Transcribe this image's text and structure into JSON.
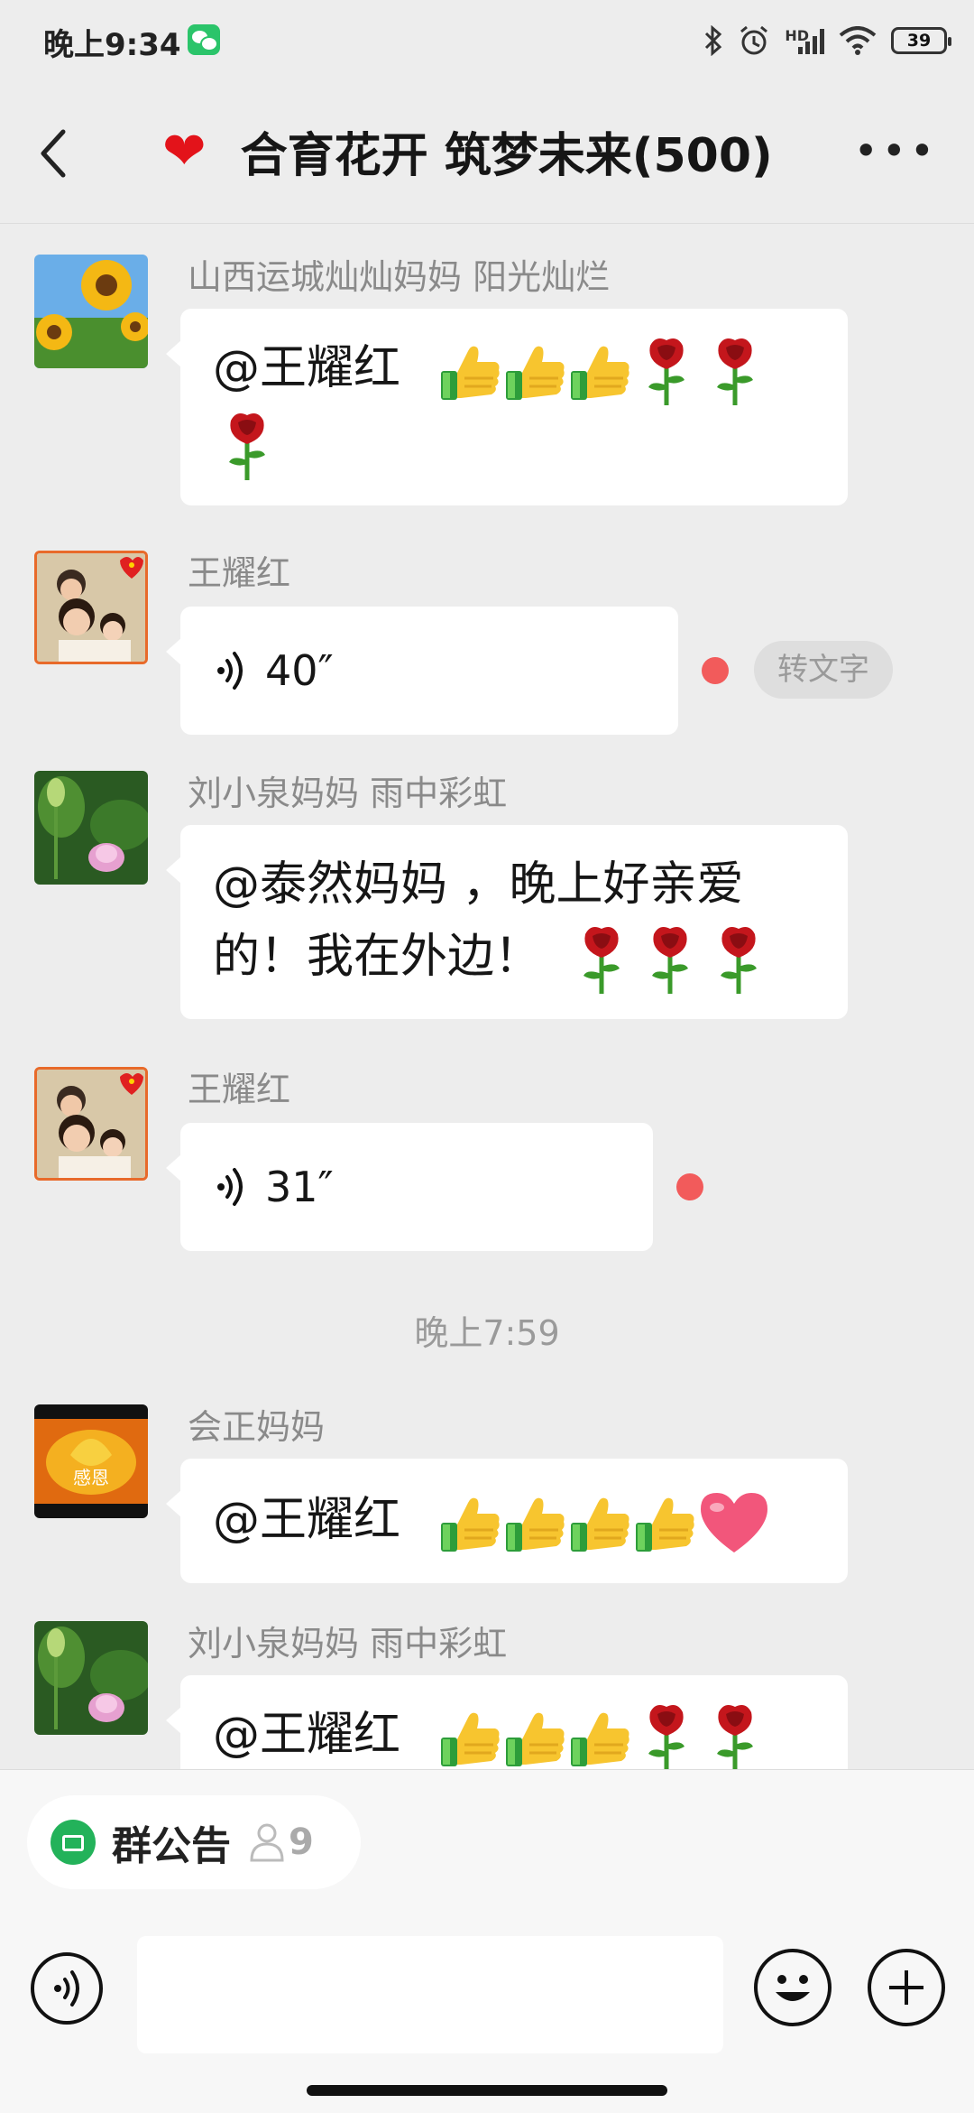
{
  "status_bar": {
    "time": "晚上9:34",
    "app_badge_icon": "wechat-icon",
    "icons": [
      "bluetooth-icon",
      "alarm-icon",
      "hd-signal-icon",
      "wifi-icon",
      "battery-icon"
    ],
    "hd_label": "HD",
    "battery_level": "39"
  },
  "nav": {
    "back_icon": "chevron-left-icon",
    "title_emoji": "❤",
    "title": "合育花开 筑梦未来(500)",
    "more_icon": "more-icon"
  },
  "messages": [
    {
      "sender": "山西运城灿灿妈妈  阳光灿烂",
      "type": "text",
      "mention": "@王耀红",
      "emojis": [
        "thumbs-up",
        "thumbs-up",
        "thumbs-up",
        "rose",
        "rose",
        "rose"
      ]
    },
    {
      "sender": "王耀红",
      "type": "voice",
      "duration": "40″",
      "unread": true,
      "convert_label": "转文字"
    },
    {
      "sender": "刘小泉妈妈  雨中彩虹",
      "type": "text",
      "line1": "@泰然妈妈 ，晚上好亲爱",
      "line2": "的！我在外边！",
      "emojis": [
        "rose",
        "rose",
        "rose"
      ]
    },
    {
      "sender": "王耀红",
      "type": "voice",
      "duration": "31″",
      "unread": true
    },
    {
      "type": "time",
      "text": "晚上7:59"
    },
    {
      "sender": "会正妈妈",
      "type": "text",
      "mention": "@王耀红",
      "avatar_text": "感恩",
      "emojis": [
        "thumbs-up",
        "thumbs-up",
        "thumbs-up",
        "thumbs-up",
        "heart"
      ]
    },
    {
      "sender": "刘小泉妈妈  雨中彩虹",
      "type": "text",
      "mention": "@王耀红",
      "emojis": [
        "thumbs-up",
        "thumbs-up",
        "thumbs-up",
        "rose",
        "rose"
      ]
    }
  ],
  "bottom": {
    "notice_label": "群公告",
    "notice_count": "9",
    "voice_icon": "voice-input-icon",
    "emoji_icon": "emoji-icon",
    "plus_icon": "plus-icon"
  },
  "colors": {
    "background": "#ededed",
    "bubble": "#ffffff",
    "unread_dot": "#f25b5b",
    "notice_green": "#23b25a",
    "heart_red": "#e3131a"
  }
}
